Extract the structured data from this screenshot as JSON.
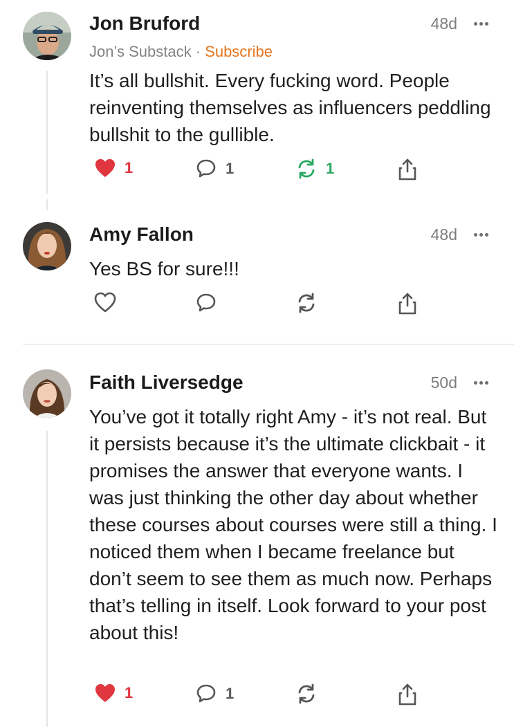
{
  "comments": [
    {
      "author": "Jon Bruford",
      "time": "48d",
      "publication": "Jon’s Substack",
      "separator": "·",
      "subscribe": "Subscribe",
      "text": "It’s all bullshit. Every fucking word. People reinventing themselves as influencers peddling bullshit to the gullible.",
      "likes": "1",
      "replies": "1",
      "restacks": "1",
      "liked": true,
      "restacked": true
    },
    {
      "author": "Amy Fallon",
      "time": "48d",
      "text": "Yes BS for sure!!!",
      "liked": false,
      "restacked": false
    },
    {
      "author": "Faith Liversedge",
      "time": "50d",
      "text": "You’ve got it totally right Amy - it’s not real. But it persists because it’s the ultimate clickbait - it promises the answer that everyone wants. I was just thinking the other day about whether these courses about courses were still a thing. I noticed them when I became freelance but don’t seem to see them as much now. Perhaps that’s telling in itself. Look forward to your post about this!",
      "likes": "1",
      "replies": "1",
      "liked": true,
      "restacked": false
    }
  ],
  "icons": {
    "heart": "heart-icon",
    "reply": "speech-bubble-icon",
    "restack": "restack-arrows-icon",
    "share": "share-icon",
    "more": "ellipsis-icon"
  },
  "colors": {
    "like_active": "#e0363f",
    "restack_active": "#2aa861",
    "subscribe": "#e8741e",
    "muted": "#7d7d7d"
  }
}
